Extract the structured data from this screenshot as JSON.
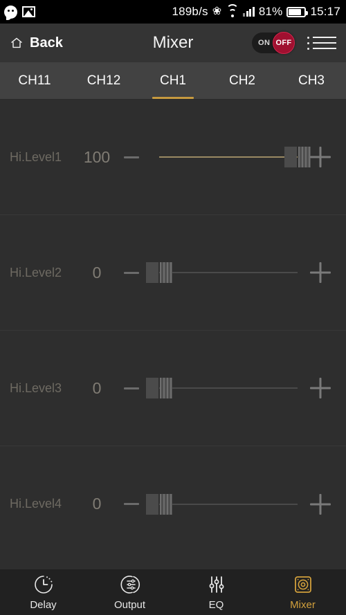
{
  "statusbar": {
    "left_icons": [
      "wechat-icon",
      "gallery-icon"
    ],
    "net_speed": "189b/s",
    "bluetooth_icon": "ᛗ",
    "battery_percent": "81%",
    "time": "15:17"
  },
  "header": {
    "back_label": "Back",
    "home_icon": "home-icon",
    "title": "Mixer",
    "toggle": {
      "on_label": "ON",
      "off_label": "OFF",
      "state": "OFF",
      "active_color": "#a01030"
    },
    "menu_icon": "list-menu-icon"
  },
  "tabs": {
    "active_index": 2,
    "accent": "#c79a3f",
    "items": [
      {
        "label": "CH11"
      },
      {
        "label": "CH12"
      },
      {
        "label": "CH1"
      },
      {
        "label": "CH2"
      },
      {
        "label": "CH3"
      }
    ]
  },
  "mixer_rows": [
    {
      "label": "Hi.Level1",
      "value": "100",
      "percent": 100
    },
    {
      "label": "Hi.Level2",
      "value": "0",
      "percent": 0
    },
    {
      "label": "Hi.Level3",
      "value": "0",
      "percent": 0
    },
    {
      "label": "Hi.Level4",
      "value": "0",
      "percent": 0
    }
  ],
  "bottom_nav": {
    "active_index": 3,
    "active_color": "#d2a03c",
    "items": [
      {
        "label": "Delay",
        "icon": "clock-icon"
      },
      {
        "label": "Output",
        "icon": "output-circle-icon"
      },
      {
        "label": "EQ",
        "icon": "equalizer-faders-icon"
      },
      {
        "label": "Mixer",
        "icon": "speaker-square-icon"
      }
    ]
  }
}
